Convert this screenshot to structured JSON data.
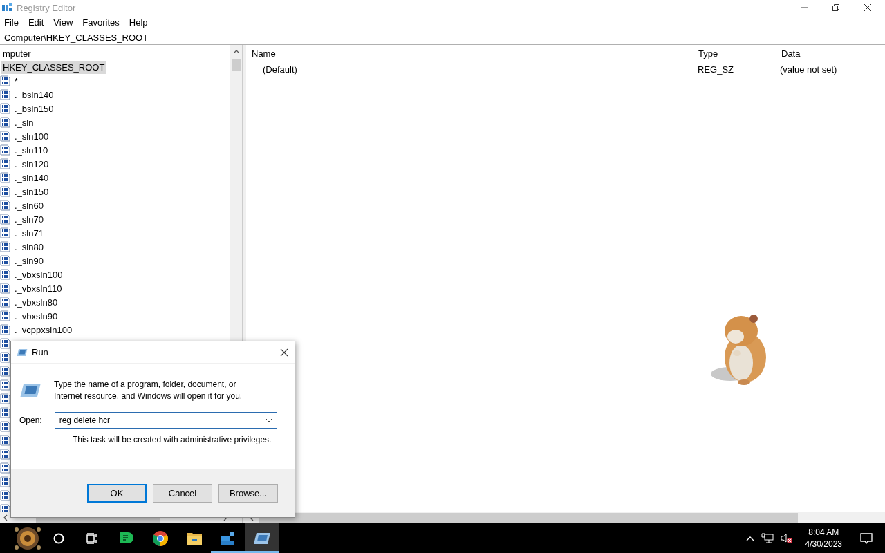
{
  "window": {
    "title": "Registry Editor"
  },
  "menu": [
    "File",
    "Edit",
    "View",
    "Favorites",
    "Help"
  ],
  "address": "Computer\\HKEY_CLASSES_ROOT",
  "tree": {
    "label": "mputer",
    "selected": false,
    "children": [
      {
        "label": "HKEY_CLASSES_ROOT",
        "selected": true,
        "children": [
          {
            "label": "*",
            "selected": false
          },
          {
            "label": "._bsln140",
            "selected": false
          },
          {
            "label": "._bsln150",
            "selected": false
          },
          {
            "label": "._sln",
            "selected": false
          },
          {
            "label": "._sln100",
            "selected": false
          },
          {
            "label": "._sln110",
            "selected": false
          },
          {
            "label": "._sln120",
            "selected": false
          },
          {
            "label": "._sln140",
            "selected": false
          },
          {
            "label": "._sln150",
            "selected": false
          },
          {
            "label": "._sln60",
            "selected": false
          },
          {
            "label": "._sln70",
            "selected": false
          },
          {
            "label": "._sln71",
            "selected": false
          },
          {
            "label": "._sln80",
            "selected": false
          },
          {
            "label": "._sln90",
            "selected": false
          },
          {
            "label": "._vbxsln100",
            "selected": false
          },
          {
            "label": "._vbxsln110",
            "selected": false
          },
          {
            "label": "._vbxsln80",
            "selected": false
          },
          {
            "label": "._vbxsln90",
            "selected": false
          },
          {
            "label": "._vcppxsln100",
            "selected": false
          }
        ]
      }
    ]
  },
  "values": {
    "columns": [
      "Name",
      "Type",
      "Data"
    ],
    "rows": [
      {
        "name": "(Default)",
        "type": "REG_SZ",
        "data": "(value not set)"
      }
    ]
  },
  "run_dialog": {
    "title": "Run",
    "description": "Type the name of a program, folder, document, or Internet resource, and Windows will open it for you.",
    "open_label": "Open:",
    "value": "reg delete hcr",
    "note": "This task will be created with administrative privileges.",
    "buttons": [
      {
        "label": "OK",
        "default": true
      },
      {
        "label": "Cancel",
        "default": false
      },
      {
        "label": "Browse...",
        "default": false
      }
    ]
  },
  "taskbar": {
    "apps": [
      {
        "kind": "start",
        "running": false,
        "selected": false
      },
      {
        "kind": "search",
        "running": false,
        "selected": false
      },
      {
        "kind": "taskview",
        "running": false,
        "selected": false
      },
      {
        "kind": "chat",
        "running": false,
        "selected": false
      },
      {
        "kind": "chrome",
        "running": false,
        "selected": false
      },
      {
        "kind": "explorer",
        "running": false,
        "selected": false
      },
      {
        "kind": "registry",
        "running": true,
        "selected": false
      },
      {
        "kind": "run",
        "running": true,
        "selected": true
      }
    ],
    "time": "8:04 AM",
    "date": "4/30/2023"
  }
}
